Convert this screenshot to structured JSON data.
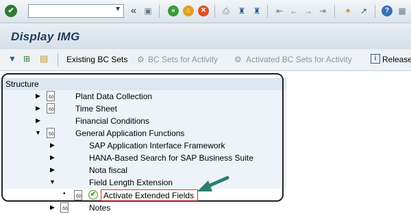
{
  "toolbar": {
    "command_field": {
      "value": "",
      "placeholder": ""
    },
    "icons": {
      "ok": "✔",
      "back_arrows": "«",
      "save": "▣",
      "back": "«",
      "exit": "⌂",
      "cancel": "✕",
      "print": "⎙",
      "find": "♜",
      "find_next": "♜",
      "first_page": "⇤",
      "prev_page": "←",
      "next_page": "→",
      "last_page": "⇥",
      "new_session": "✶",
      "shortcut": "↗",
      "help": "?",
      "customize": "▦"
    },
    "colors": {
      "back": "#3a9b3a",
      "exit": "#e0a020",
      "cancel": "#e05020",
      "help": "#3b6fb6"
    }
  },
  "title": "Display IMG",
  "app_toolbar": {
    "existing_bc_sets": "Existing BC Sets",
    "bc_sets_for_activity": "BC Sets for Activity",
    "activated_bc_sets_for_activity": "Activated BC Sets for Activity",
    "release": "Release"
  },
  "tree": {
    "header": "Structure",
    "rows": [
      {
        "label": "Plant Data Collection",
        "expand": "▶",
        "has_doc": true
      },
      {
        "label": "Time Sheet",
        "expand": "▶",
        "has_doc": true
      },
      {
        "label": "Financial Conditions",
        "expand": "▶",
        "has_doc": false
      },
      {
        "label": "General Application Functions",
        "expand": "▼",
        "has_doc": true
      },
      {
        "label": "SAP Application Interface Framework",
        "expand": "▶",
        "has_doc": false
      },
      {
        "label": "HANA-Based Search for SAP Business Suite",
        "expand": "▶",
        "has_doc": false
      },
      {
        "label": "Nota fiscal",
        "expand": "▶",
        "has_doc": false
      },
      {
        "label": "Field Length Extension",
        "expand": "▼",
        "has_doc": false
      },
      {
        "label": "Activate Extended Fields",
        "expand": "•",
        "has_doc": true
      },
      {
        "label": "Notes",
        "expand": "▶",
        "has_doc": true
      }
    ]
  },
  "annotation": {
    "arrow_color": "#2e7d6e"
  }
}
